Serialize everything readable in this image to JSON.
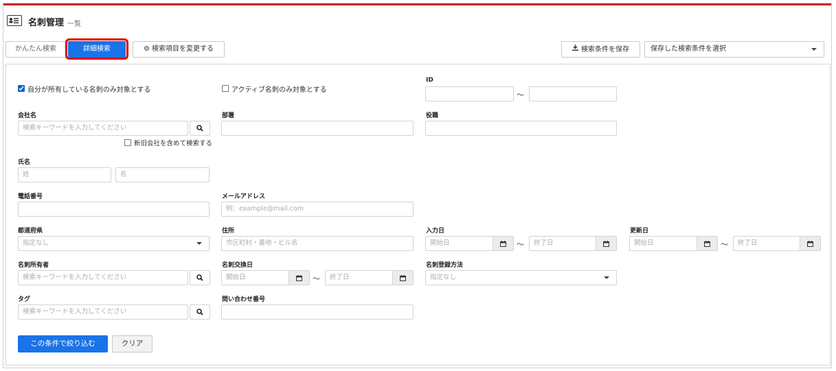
{
  "header": {
    "title": "名刺管理",
    "subtitle": "一覧"
  },
  "toolbar": {
    "simple_search": "かんたん検索",
    "detail_search": "詳細検索",
    "change_items": "検索項目を変更する",
    "save_conditions": "検索条件を保存",
    "saved_select": "保存した検索条件を選択"
  },
  "form": {
    "own_only": "自分が所有している名刺のみ対象とする",
    "active_only": "アクティブ名刺のみ対象とする",
    "id_label": "ID",
    "company_label": "会社名",
    "company_placeholder": "検索キーワードを入力してください",
    "include_old_company": "新旧会社を含めて検索する",
    "department_label": "部署",
    "position_label": "役職",
    "name_label": "氏名",
    "last_name_placeholder": "姓",
    "first_name_placeholder": "名",
    "phone_label": "電話番号",
    "email_label": "メールアドレス",
    "email_placeholder": "例：example@mail.com",
    "prefecture_label": "都道府県",
    "prefecture_value": "指定なし",
    "address_label": "住所",
    "address_placeholder": "市区町村・番地・ビル名",
    "entry_date_label": "入力日",
    "update_date_label": "更新日",
    "start_placeholder": "開始日",
    "end_placeholder": "終了日",
    "owner_label": "名刺所有者",
    "owner_placeholder": "検索キーワードを入力してください",
    "exchange_date_label": "名刺交換日",
    "register_method_label": "名刺登録方法",
    "register_method_value": "指定なし",
    "tag_label": "タグ",
    "tag_placeholder": "検索キーワードを入力してください",
    "inquiry_label": "問い合わせ番号",
    "tilde": "～",
    "submit": "この条件で絞り込む",
    "clear": "クリア"
  },
  "colors": {
    "accent": "#1a73e8",
    "highlight": "#e00000",
    "top_bar": "#c62828",
    "label": "#222222"
  }
}
